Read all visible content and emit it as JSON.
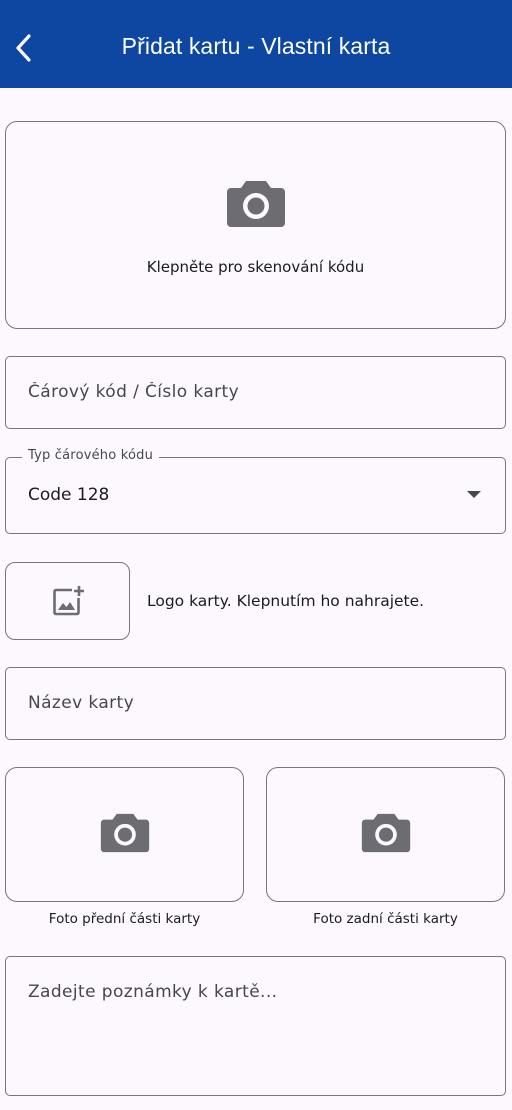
{
  "appbar": {
    "title": "Přidat kartu - Vlastní karta",
    "background": "#0d47a1"
  },
  "scan": {
    "label": "Klepněte pro skenování kódu"
  },
  "barcode": {
    "placeholder": "Čárový kód / Číslo karty"
  },
  "barcode_type": {
    "label": "Typ čárového kódu",
    "value": "Code 128"
  },
  "logo": {
    "label": "Logo karty. Klepnutím ho nahrajete."
  },
  "card_name": {
    "placeholder": "Název karty"
  },
  "photos": {
    "front_label": "Foto přední části karty",
    "back_label": "Foto zadní části karty"
  },
  "notes": {
    "placeholder": "Zadejte poznámky k kartě..."
  },
  "icons": {
    "back": "back-chevron-icon",
    "scan": "camera-icon",
    "logo": "add-image-icon",
    "front_photo": "camera-icon",
    "back_photo": "camera-icon"
  }
}
